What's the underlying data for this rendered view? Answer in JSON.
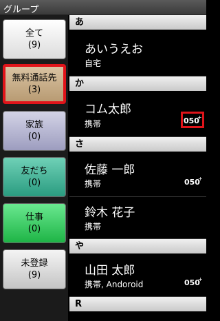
{
  "title": "グループ",
  "groups": [
    {
      "label": "全て",
      "count": "(9)",
      "bg": "#ffffff"
    },
    {
      "label": "無料通話先",
      "count": "(3)",
      "bg": "#c8ad88"
    },
    {
      "label": "家族",
      "count": "(0)",
      "bg": "#b9b9d3"
    },
    {
      "label": "友だち",
      "count": "(0)",
      "bg": "#47b89c"
    },
    {
      "label": "仕事",
      "count": "(0)",
      "bg": "#2fcf5e"
    },
    {
      "label": "未登録",
      "count": "(9)",
      "bg": "#dcdcdc"
    }
  ],
  "sections": [
    {
      "letter": "あ"
    },
    {
      "letter": "か"
    },
    {
      "letter": "さ"
    },
    {
      "letter": "や"
    },
    {
      "letter": "R"
    }
  ],
  "contacts": [
    {
      "name": "あいうえお",
      "type": "自宅",
      "free": false
    },
    {
      "name": "コム太郎",
      "type": "携帯",
      "free": true
    },
    {
      "name": "佐藤 一郎",
      "type": "携帯",
      "free": true
    },
    {
      "name": "鈴木 花子",
      "type": "携帯",
      "free": false
    },
    {
      "name": "山田 太郎",
      "type": "携帯, Andoroid",
      "free": true
    }
  ],
  "icons": {
    "free_call": "050-free-call-icon"
  },
  "colors": {
    "highlight": "#e0141a"
  }
}
